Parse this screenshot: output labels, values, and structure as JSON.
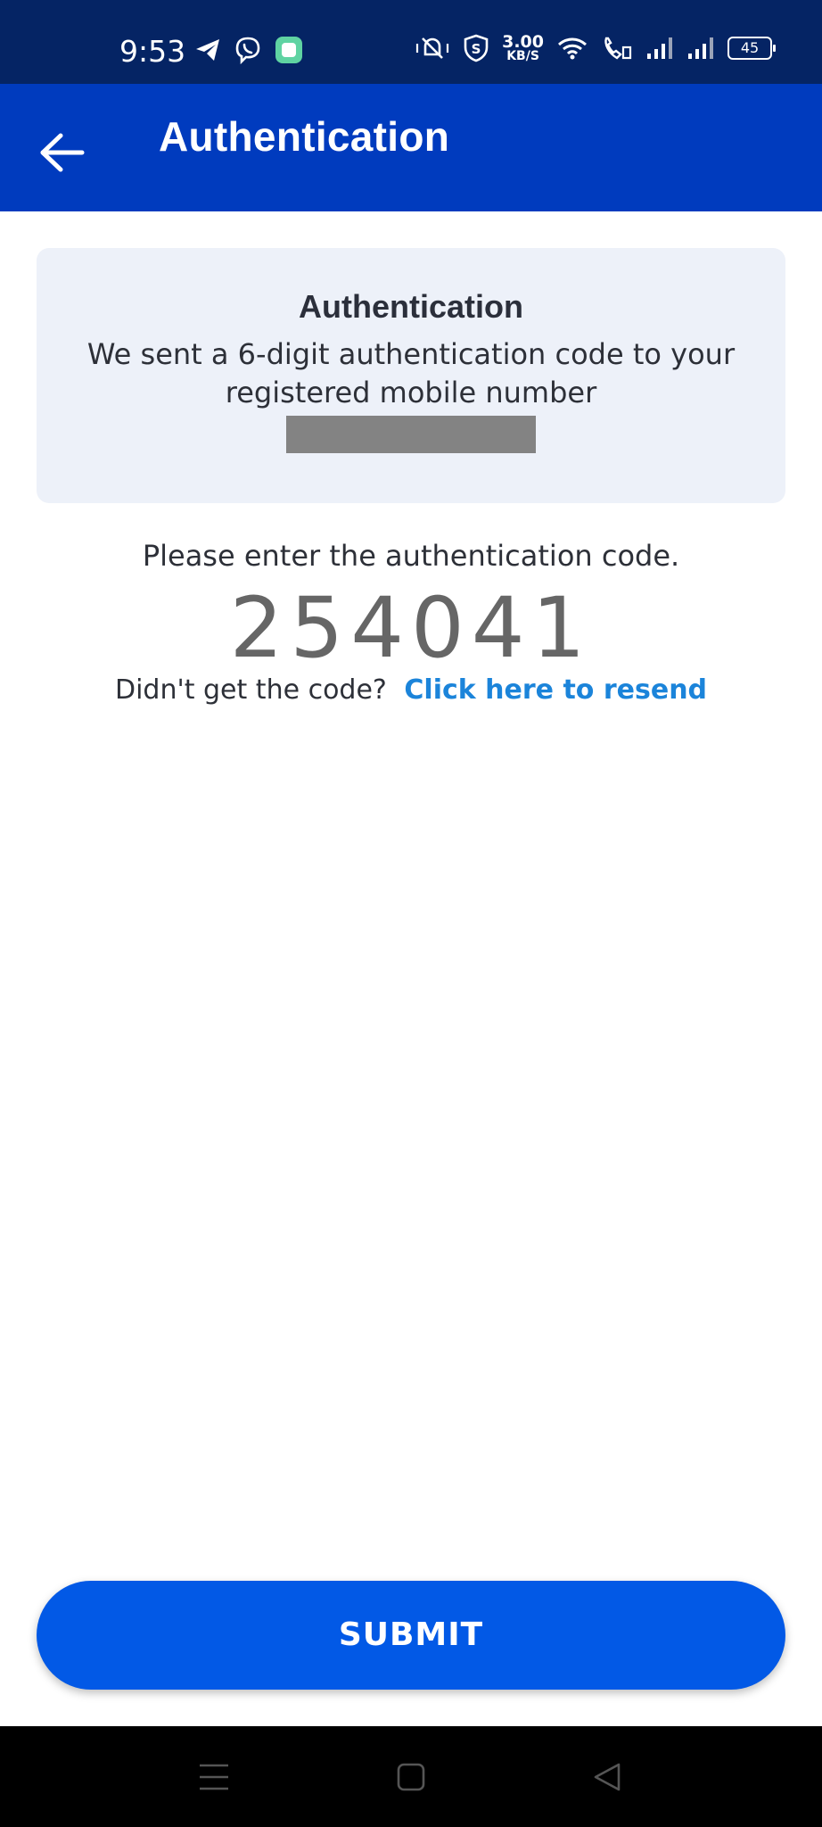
{
  "status_bar": {
    "time": "9:53",
    "network_speed_value": "3.00",
    "network_speed_unit": "KB/S",
    "battery_level": "45",
    "left_icons": [
      "telegram-icon",
      "viber-icon",
      "app-notification-icon"
    ],
    "right_icons": [
      "vibrate-mute-icon",
      "shield-icon",
      "wifi-icon",
      "wifi-calling-icon",
      "signal-icon",
      "signal-icon"
    ]
  },
  "app_bar": {
    "title": "Authentication",
    "back_icon": "arrow-left-icon",
    "background_color": "#003bbe"
  },
  "info_card": {
    "title": "Authentication",
    "message": "We sent a 6-digit authentication code to your registered mobile number"
  },
  "main": {
    "prompt": "Please enter the authentication code.",
    "code_value": "254041",
    "resend_question": "Didn't get the code?",
    "resend_link": "Click here to resend",
    "link_color": "#1b84da"
  },
  "actions": {
    "submit_label": "SUBMIT",
    "submit_color": "#0259e6"
  },
  "nav_bar": {
    "icons": [
      "menu-icon",
      "home-square-icon",
      "back-triangle-icon"
    ]
  }
}
